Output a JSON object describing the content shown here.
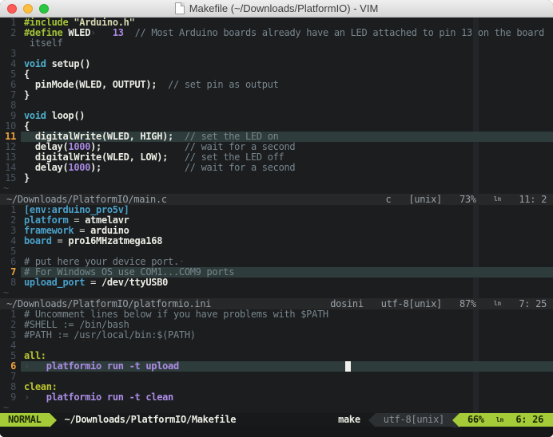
{
  "window": {
    "title": "Makefile (~/Downloads/PlatformIO) - VIM"
  },
  "icons": {
    "line_number": "ln",
    "document": "document-icon"
  },
  "colors": {
    "mode_green": "#a6cb39",
    "cursorline_bg": "#2e3d3c",
    "cursorline_number": "#eea33f",
    "spell_error": "#e0403a",
    "editor_bg": "#1b1d1f"
  },
  "panes": [
    {
      "id": "main-c",
      "status": {
        "path": "~/Downloads/PlatformIO/main.c",
        "filetype": "c",
        "format": "[unix]",
        "percent": "73%",
        "position": "11:  2"
      },
      "lines": [
        {
          "num": "1",
          "segments": [
            {
              "t": "#include",
              "c": "preproc"
            },
            {
              "t": " ",
              "c": "fg"
            },
            {
              "t": "\"Arduino.h\"",
              "c": "string"
            }
          ]
        },
        {
          "num": "2",
          "segments": [
            {
              "t": "#define",
              "c": "preproc"
            },
            {
              "t": " ",
              "c": "fg"
            },
            {
              "t": "WLED",
              "c": "fgb"
            },
            {
              "t": "›",
              "c": "tab"
            },
            {
              "t": "   ",
              "c": "fg"
            },
            {
              "t": "13",
              "c": "number"
            },
            {
              "t": "  ",
              "c": "fg"
            },
            {
              "t": "// Most Arduino boards already have an LED attached to pin 13 on the board",
              "c": "comment"
            }
          ]
        },
        {
          "num": "",
          "segments": [
            {
              "t": " itself",
              "c": "comment"
            }
          ]
        },
        {
          "num": "3",
          "segments": []
        },
        {
          "num": "4",
          "segments": [
            {
              "t": "void",
              "c": "type"
            },
            {
              "t": " ",
              "c": "fg"
            },
            {
              "t": "setup()",
              "c": "fgb"
            }
          ]
        },
        {
          "num": "5",
          "segments": [
            {
              "t": "{",
              "c": "fgb"
            }
          ]
        },
        {
          "num": "6",
          "segments": [
            {
              "t": "  ",
              "c": "fg"
            },
            {
              "t": "pinMode(WLED, OUTPUT);",
              "c": "fgb"
            },
            {
              "t": "  ",
              "c": "fg"
            },
            {
              "t": "// set pin as output",
              "c": "comment"
            }
          ]
        },
        {
          "num": "7",
          "segments": [
            {
              "t": "}",
              "c": "fgb"
            }
          ]
        },
        {
          "num": "8",
          "segments": []
        },
        {
          "num": "9",
          "segments": [
            {
              "t": "void",
              "c": "type"
            },
            {
              "t": " ",
              "c": "fg"
            },
            {
              "t": "loop()",
              "c": "fgb"
            }
          ]
        },
        {
          "num": "10",
          "segments": [
            {
              "t": "{",
              "c": "fgb"
            }
          ]
        },
        {
          "num": "11",
          "cursor": true,
          "segments": [
            {
              "t": "  ",
              "c": "fg"
            },
            {
              "t": "digitalWrite(WLED, HIGH);",
              "c": "fgb"
            },
            {
              "t": "  ",
              "c": "fg"
            },
            {
              "t": "// set the LED on",
              "c": "comment"
            }
          ]
        },
        {
          "num": "12",
          "segments": [
            {
              "t": "  ",
              "c": "fg"
            },
            {
              "t": "delay(",
              "c": "fgb"
            },
            {
              "t": "1000",
              "c": "number"
            },
            {
              "t": ");",
              "c": "fgb"
            },
            {
              "t": "               ",
              "c": "fg"
            },
            {
              "t": "// wait for a second",
              "c": "comment"
            }
          ]
        },
        {
          "num": "13",
          "segments": [
            {
              "t": "  ",
              "c": "fg"
            },
            {
              "t": "digitalWrite(WLED, LOW);",
              "c": "fgb"
            },
            {
              "t": "   ",
              "c": "fg"
            },
            {
              "t": "// set the LED off",
              "c": "comment"
            }
          ]
        },
        {
          "num": "14",
          "segments": [
            {
              "t": "  ",
              "c": "fg"
            },
            {
              "t": "delay(",
              "c": "fgb"
            },
            {
              "t": "1000",
              "c": "number"
            },
            {
              "t": ");",
              "c": "fgb"
            },
            {
              "t": "               ",
              "c": "fg"
            },
            {
              "t": "// wait for a second",
              "c": "comment"
            }
          ]
        },
        {
          "num": "15",
          "segments": [
            {
              "t": "}",
              "c": "fgb"
            }
          ]
        },
        {
          "tilde": true
        }
      ]
    },
    {
      "id": "platformio-ini",
      "status": {
        "path": "~/Downloads/PlatformIO/platformio.ini",
        "filetype": "dosini",
        "format": "utf-8[unix]",
        "percent": "87%",
        "position": "7: 25"
      },
      "lines": [
        {
          "num": "1",
          "segments": [
            {
              "t": "[env:",
              "c": "section"
            },
            {
              "t": "arduino_pro5v",
              "c": "section",
              "spell": true
            },
            {
              "t": "]",
              "c": "section"
            }
          ]
        },
        {
          "num": "2",
          "segments": [
            {
              "t": "platform",
              "c": "key"
            },
            {
              "t": " = ",
              "c": "fg"
            },
            {
              "t": "atmelavr",
              "c": "value",
              "spell": true
            }
          ]
        },
        {
          "num": "3",
          "segments": [
            {
              "t": "framework",
              "c": "key"
            },
            {
              "t": " = ",
              "c": "fg"
            },
            {
              "t": "arduino",
              "c": "value",
              "spell": true
            }
          ]
        },
        {
          "num": "4",
          "segments": [
            {
              "t": "board",
              "c": "key"
            },
            {
              "t": " = ",
              "c": "fg"
            },
            {
              "t": "pro16MHzatmega168",
              "c": "value",
              "spell": true
            }
          ]
        },
        {
          "num": "5",
          "segments": []
        },
        {
          "num": "6",
          "segments": [
            {
              "t": "# put here your device port.",
              "c": "comment"
            },
            {
              "t": "·",
              "c": "tab"
            }
          ]
        },
        {
          "num": "7",
          "cursor": true,
          "segments": [
            {
              "t": "# For Windows OS use ",
              "c": "comment"
            },
            {
              "t": "COM1",
              "c": "comment",
              "spell": true
            },
            {
              "t": "...",
              "c": "comment"
            },
            {
              "t": "COM9",
              "c": "comment",
              "spell": true
            },
            {
              "t": " ports",
              "c": "comment"
            }
          ]
        },
        {
          "num": "8",
          "segments": [
            {
              "t": "upload_port",
              "c": "key"
            },
            {
              "t": " = ",
              "c": "fg"
            },
            {
              "t": "/dev/",
              "c": "value"
            },
            {
              "t": "ttyUSB0",
              "c": "value",
              "spell": true
            }
          ]
        },
        {
          "tilde": true
        }
      ]
    },
    {
      "id": "makefile",
      "status": null,
      "lines": [
        {
          "num": "1",
          "segments": [
            {
              "t": "# Uncomment lines below if you have problems with $PATH",
              "c": "comment"
            }
          ]
        },
        {
          "num": "2",
          "segments": [
            {
              "t": "#SHELL := /bin/bash",
              "c": "comment"
            }
          ]
        },
        {
          "num": "3",
          "segments": [
            {
              "t": "#PATH := /",
              "c": "comment"
            },
            {
              "t": "usr",
              "c": "comment",
              "spell": true
            },
            {
              "t": "/local/bin:$(PATH)",
              "c": "comment"
            }
          ]
        },
        {
          "num": "4",
          "segments": []
        },
        {
          "num": "5",
          "segments": [
            {
              "t": "all:",
              "c": "target"
            }
          ]
        },
        {
          "num": "6",
          "cursor": true,
          "segments": [
            {
              "t": "›",
              "c": "tab"
            },
            {
              "t": "   ",
              "c": "fg"
            },
            {
              "t": "platformio run -t upload",
              "c": "recipe"
            },
            {
              "t": "                              ",
              "c": "fg"
            },
            {
              "t": " ",
              "c": "cursorblock"
            }
          ]
        },
        {
          "num": "7",
          "segments": []
        },
        {
          "num": "8",
          "segments": [
            {
              "t": "clean:",
              "c": "target"
            }
          ]
        },
        {
          "num": "9",
          "segments": [
            {
              "t": "›",
              "c": "tab"
            },
            {
              "t": "   ",
              "c": "fg"
            },
            {
              "t": "platformio run -t clean",
              "c": "recipe"
            }
          ]
        },
        {
          "tilde": true
        }
      ]
    }
  ],
  "bottom_bar": {
    "mode": "NORMAL",
    "path": "~/Downloads/PlatformIO/Makefile",
    "filetype": "make",
    "encoding": "utf-8[unix]",
    "percent": "66%",
    "position": "6: 26"
  }
}
